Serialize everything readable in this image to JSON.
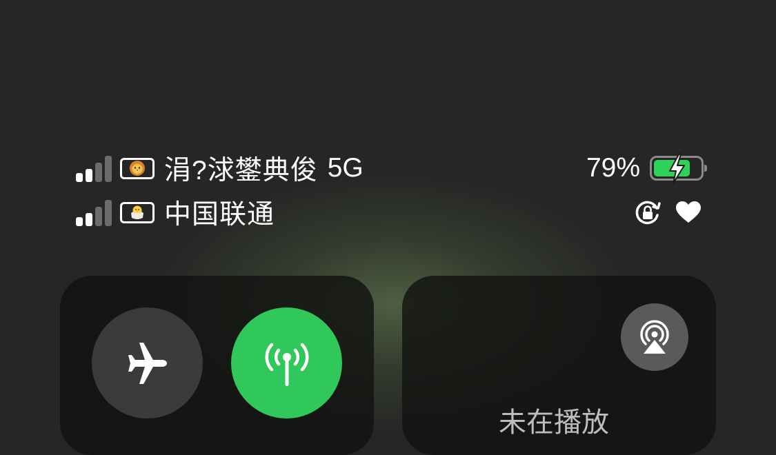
{
  "status_bar": {
    "sim1": {
      "carrier": "涓?浗鐢典俊",
      "network_type": "5G",
      "signal_bars_active": 2,
      "signal_bars_total": 4,
      "badge_icon": "lion-emoji-icon"
    },
    "sim2": {
      "carrier": "中国联通",
      "signal_bars_active": 2,
      "signal_bars_total": 4,
      "badge_icon": "hatching-chick-emoji-icon"
    },
    "battery": {
      "percent_label": "79%",
      "level": 0.79,
      "charging": true,
      "color": "#30d158"
    },
    "indicators": [
      "rotation-lock-icon",
      "heart-icon"
    ]
  },
  "connectivity_tile": {
    "airplane_mode": {
      "icon": "airplane-icon",
      "on": false
    },
    "cellular_data": {
      "icon": "cellular-antenna-icon",
      "on": true,
      "color": "#30c85a"
    }
  },
  "media_tile": {
    "label": "未在播放",
    "airplay_icon": "airplay-audio-icon"
  }
}
